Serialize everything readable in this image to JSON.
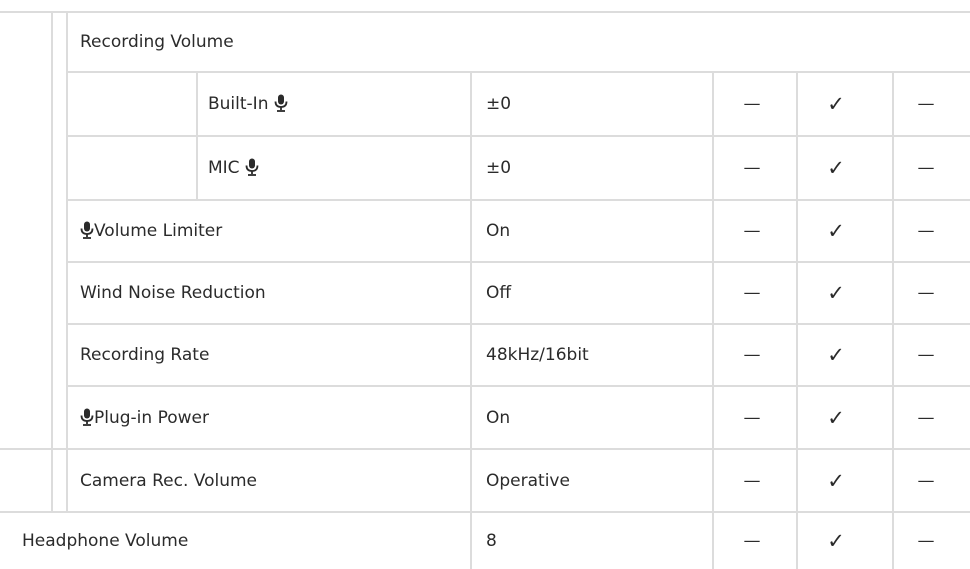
{
  "table": {
    "section_label": "Recording Volume",
    "rows": [
      {
        "name": "row-built-in",
        "label": "Built-In",
        "mic_suffix": true,
        "value": "±0",
        "col1": "—",
        "col2": "✓",
        "col3": "—"
      },
      {
        "name": "row-mic",
        "label": "MIC",
        "mic_suffix": true,
        "value": "±0",
        "col1": "—",
        "col2": "✓",
        "col3": "—"
      },
      {
        "name": "row-volume-limiter",
        "label": "Volume Limiter",
        "mic_prefix": true,
        "value": "On",
        "col1": "—",
        "col2": "✓",
        "col3": "—"
      },
      {
        "name": "row-wind-noise-reduction",
        "label": "Wind Noise Reduction",
        "value": "Off",
        "col1": "—",
        "col2": "✓",
        "col3": "—"
      },
      {
        "name": "row-recording-rate",
        "label": "Recording Rate",
        "value": "48kHz/16bit",
        "col1": "—",
        "col2": "✓",
        "col3": "—"
      },
      {
        "name": "row-plug-in-power",
        "label": "Plug-in Power",
        "mic_prefix": true,
        "value": "On",
        "col1": "—",
        "col2": "✓",
        "col3": "—"
      },
      {
        "name": "row-camera-rec-volume",
        "label": "Camera Rec. Volume",
        "value": "Operative",
        "col1": "—",
        "col2": "✓",
        "col3": "—"
      },
      {
        "name": "row-headphone-volume",
        "label": "Headphone Volume",
        "value": "8",
        "col1": "—",
        "col2": "✓",
        "col3": "—"
      }
    ]
  },
  "icons": {
    "mic": "microphone-icon"
  }
}
